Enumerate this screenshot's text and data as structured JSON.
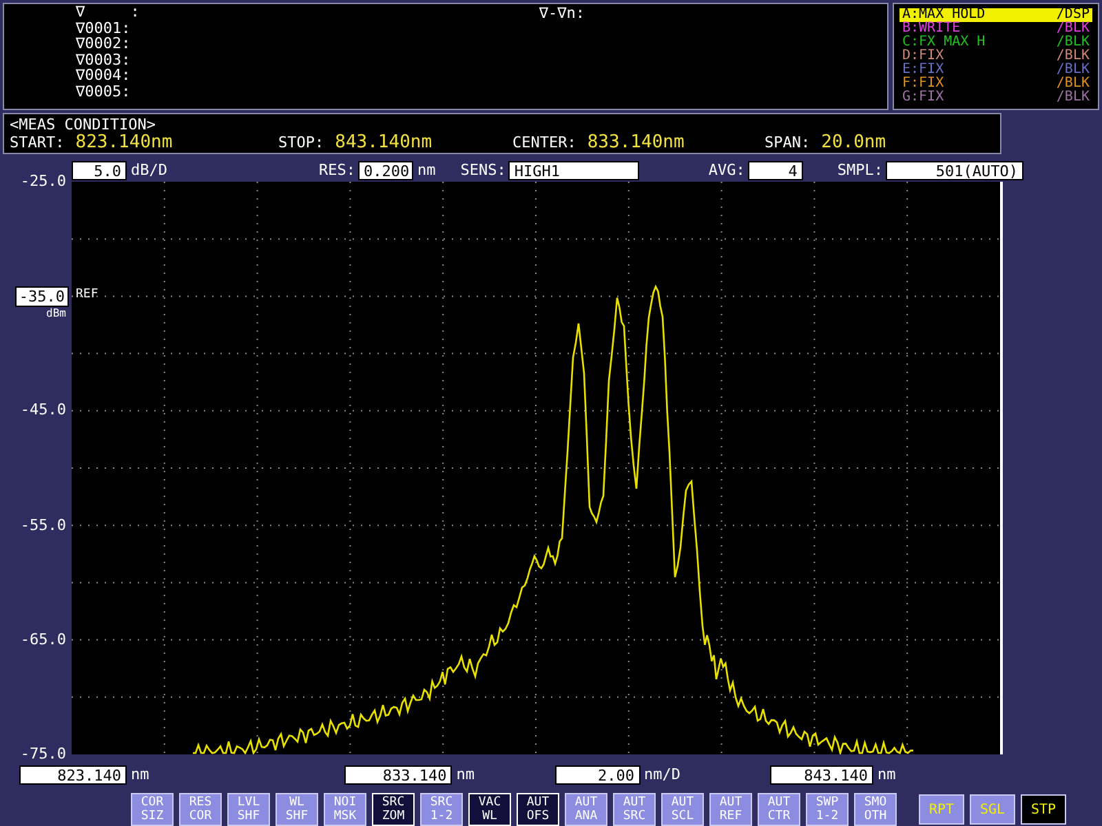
{
  "markers": {
    "items": [
      "∇     :",
      "∇0001:",
      "∇0002:",
      "∇0003:",
      "∇0004:",
      "∇0005:"
    ],
    "delta_label": "∇-∇n:"
  },
  "traces": [
    {
      "label": "A:MAX HOLD",
      "mode": "/DSP",
      "color": "#f0f000",
      "selected": true
    },
    {
      "label": "B:WRITE",
      "mode": "/BLK",
      "color": "#e040e0",
      "selected": false
    },
    {
      "label": "C:FX MAX H",
      "mode": "/BLK",
      "color": "#20c020",
      "selected": false
    },
    {
      "label": "D:FIX",
      "mode": "/BLK",
      "color": "#d08878",
      "selected": false
    },
    {
      "label": "E:FIX",
      "mode": "/BLK",
      "color": "#6870c8",
      "selected": false
    },
    {
      "label": "F:FIX",
      "mode": "/BLK",
      "color": "#e09020",
      "selected": false
    },
    {
      "label": "G:FIX",
      "mode": "/BLK",
      "color": "#a070a8",
      "selected": false
    }
  ],
  "meas_condition": {
    "title": "<MEAS CONDITION>",
    "fields": [
      {
        "label": "START:",
        "value": "823.140nm"
      },
      {
        "label": "STOP:",
        "value": "843.140nm"
      },
      {
        "label": "CENTER:",
        "value": "833.140nm"
      },
      {
        "label": "SPAN:",
        "value": "20.0nm"
      }
    ]
  },
  "settings": {
    "scale": "5.0",
    "scale_unit": "dB/D",
    "res_label": "RES:",
    "res": "0.200",
    "res_unit": "nm",
    "sens_label": "SENS:",
    "sens": "HIGH1",
    "avg_label": "AVG:",
    "avg": "4",
    "smpl_label": "SMPL:",
    "smpl": "501(AUTO)"
  },
  "y_axis": {
    "labels": [
      {
        "text": "-25.0",
        "kind": "tick"
      },
      {
        "text": "-35.0",
        "kind": "reference"
      },
      {
        "text": "-45.0",
        "kind": "tick"
      },
      {
        "text": "-55.0",
        "kind": "tick"
      },
      {
        "text": "-65.0",
        "kind": "tick"
      },
      {
        "text": "-75.0",
        "kind": "tick"
      }
    ],
    "ref_unit": "dBm",
    "ref_label": "REF"
  },
  "x_axis": {
    "start": "823.140",
    "start_unit": "nm",
    "center": "833.140",
    "center_unit": "nm",
    "span_div": "2.00",
    "span_div_unit": "nm/D",
    "stop": "843.140",
    "stop_unit": "nm"
  },
  "softkeys": [
    {
      "lines": [
        "COR",
        "SIZ"
      ],
      "selected": false
    },
    {
      "lines": [
        "RES",
        "COR"
      ],
      "selected": false
    },
    {
      "lines": [
        "LVL",
        "SHF"
      ],
      "selected": false
    },
    {
      "lines": [
        "WL",
        "SHF"
      ],
      "selected": false
    },
    {
      "lines": [
        "NOI",
        "MSK"
      ],
      "selected": false
    },
    {
      "lines": [
        "SRC",
        "ZOM"
      ],
      "selected": true
    },
    {
      "lines": [
        "SRC",
        "1-2"
      ],
      "selected": false
    },
    {
      "lines": [
        "VAC",
        "WL"
      ],
      "selected": true
    },
    {
      "lines": [
        "AUT",
        "OFS"
      ],
      "selected": true
    },
    {
      "lines": [
        "AUT",
        "ANA"
      ],
      "selected": false
    },
    {
      "lines": [
        "AUT",
        "SRC"
      ],
      "selected": false
    },
    {
      "lines": [
        "AUT",
        "SCL"
      ],
      "selected": false
    },
    {
      "lines": [
        "AUT",
        "REF"
      ],
      "selected": false
    },
    {
      "lines": [
        "AUT",
        "CTR"
      ],
      "selected": false
    },
    {
      "lines": [
        "SWP",
        "1-2"
      ],
      "selected": false
    },
    {
      "lines": [
        "SMO",
        "OTH"
      ],
      "selected": false
    }
  ],
  "sweep_keys": [
    {
      "label": "RPT",
      "selected": false
    },
    {
      "label": "SGL",
      "selected": false
    },
    {
      "label": "STP",
      "selected": true
    }
  ]
}
